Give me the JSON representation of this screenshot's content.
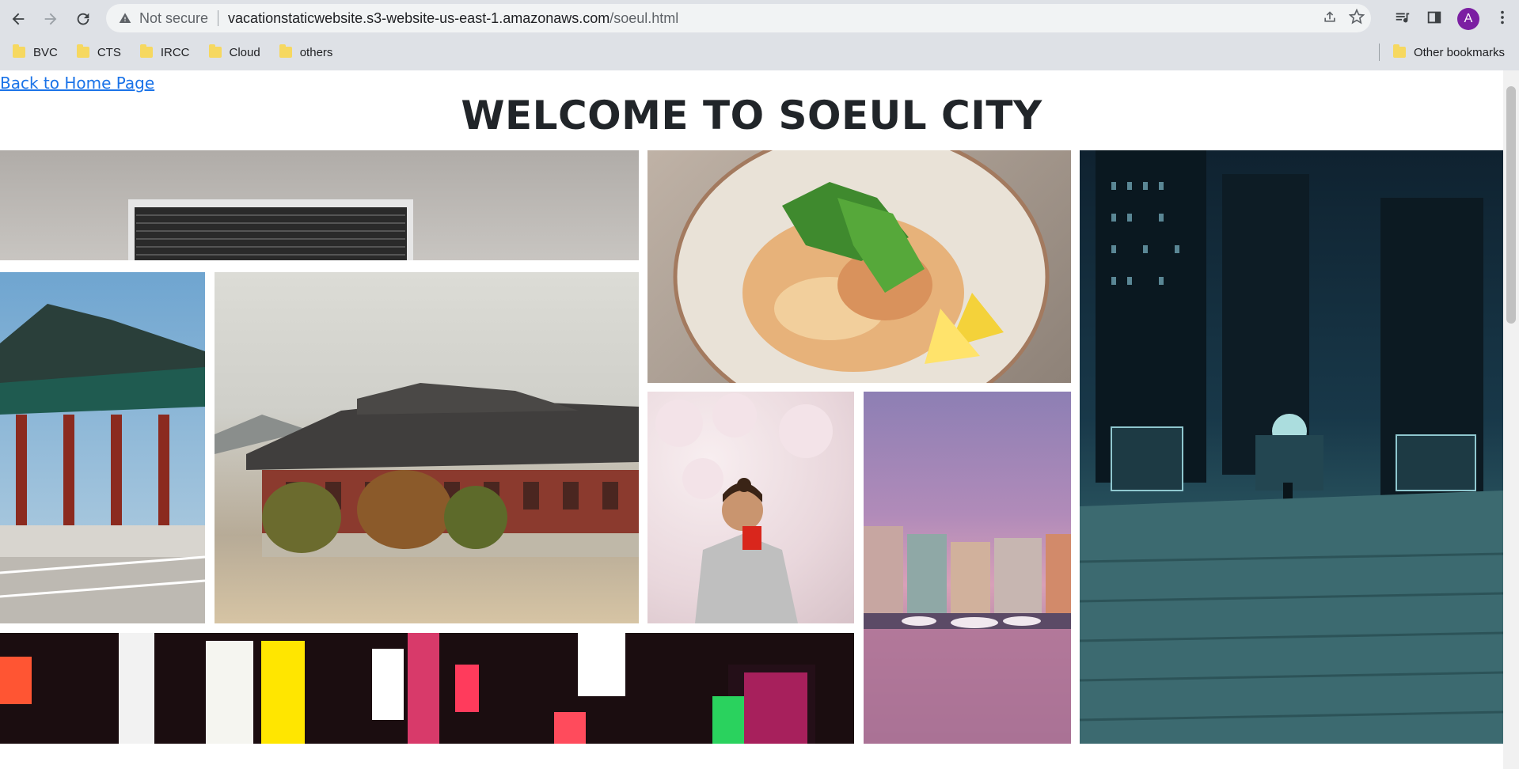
{
  "browser": {
    "security_label": "Not secure",
    "url_host": "vacationstaticwebsite.s3-website-us-east-1.amazonaws.com",
    "url_path": "/soeul.html",
    "avatar_initial": "A",
    "bookmarks": [
      "BVC",
      "CTS",
      "IRCC",
      "Cloud",
      "others"
    ],
    "other_bookmarks": "Other bookmarks"
  },
  "page": {
    "back_link": "Back to Home Page",
    "title": "WELCOME TO SOEUL CITY"
  },
  "colors": {
    "link": "#1a73e8",
    "heading": "#212529",
    "avatar": "#7b1fa2"
  }
}
